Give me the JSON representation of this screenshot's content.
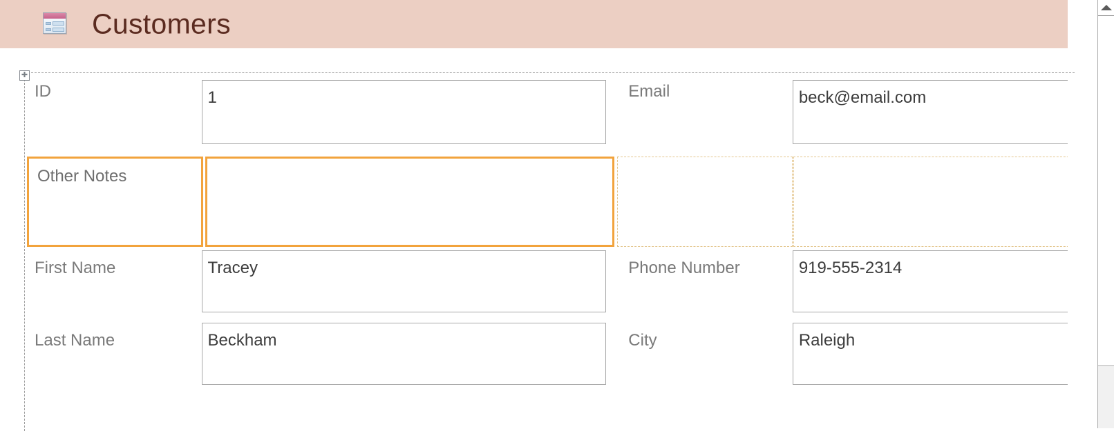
{
  "window": {
    "form_title": "Customers",
    "form_icon": "form-icon",
    "header_background": "#eccfc3",
    "title_color": "#5b2b20",
    "selection_color": "#f2a33c"
  },
  "form": {
    "move_handle_icon": "move-handle-icon",
    "rows": [
      {
        "id": "id-row",
        "left": {
          "label": "ID",
          "value": "1",
          "selected": false,
          "empty": false
        },
        "right": {
          "label": "Email",
          "value": "beck@email.com",
          "selected": false,
          "empty": false
        }
      },
      {
        "id": "other-notes-row",
        "left": {
          "label": "Other Notes",
          "value": "",
          "selected": true,
          "empty": false
        },
        "right": {
          "label": "",
          "value": "",
          "selected": false,
          "empty": true
        }
      },
      {
        "id": "first-name-row",
        "left": {
          "label": "First Name",
          "value": "Tracey",
          "selected": false,
          "empty": false
        },
        "right": {
          "label": "Phone Number",
          "value": "919-555-2314",
          "selected": false,
          "empty": false
        }
      },
      {
        "id": "last-name-row",
        "left": {
          "label": "Last Name",
          "value": "Beckham",
          "selected": false,
          "empty": false
        },
        "right": {
          "label": "City",
          "value": "Raleigh",
          "selected": false,
          "empty": false
        }
      }
    ]
  },
  "scrollbar": {
    "up_arrow_icon": "scroll-up-arrow-icon",
    "orientation": "vertical"
  }
}
